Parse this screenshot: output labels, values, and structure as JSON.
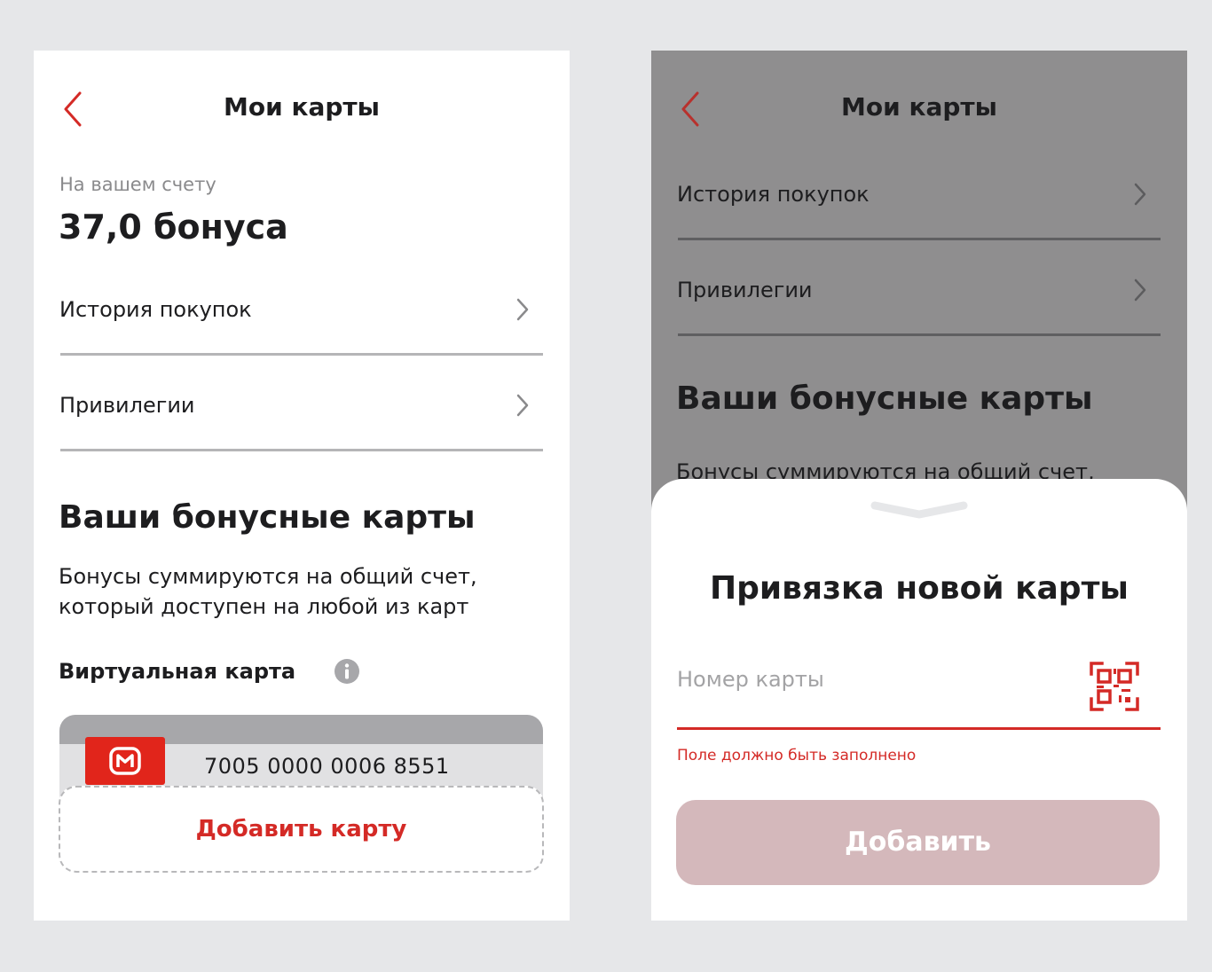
{
  "colors": {
    "accent": "#d42a26",
    "page_background": "#e6e7e9",
    "overlay": "#8f8e8f",
    "disabled_button": "#d4b8bb",
    "brand_logo": "#e1251b"
  },
  "left_screen": {
    "header": {
      "title": "Мои карты",
      "back_icon": "chevron-left-icon"
    },
    "balance": {
      "label": "На вашем счету",
      "value": "37,0 бонуса"
    },
    "menu": [
      {
        "label": "История покупок",
        "icon": "chevron-right-icon"
      },
      {
        "label": "Привилегии",
        "icon": "chevron-right-icon"
      }
    ],
    "bonus_cards": {
      "title": "Ваши бонусные карты",
      "description_line1": "Бонусы суммируются на общий счет,",
      "description_line2": "который доступен на любой из карт",
      "virtual_card_label": "Виртуальная карта",
      "info_icon": "info-icon",
      "card_number": "7005 0000 0006 8551",
      "logo_icon": "magnit-logo-icon",
      "add_card_label": "Добавить карту"
    }
  },
  "right_screen": {
    "header": {
      "title": "Мои карты",
      "back_icon": "chevron-left-icon"
    },
    "menu": [
      {
        "label": "История покупок",
        "icon": "chevron-right-icon"
      },
      {
        "label": "Привилегии",
        "icon": "chevron-right-icon"
      }
    ],
    "bonus_cards": {
      "title": "Ваши бонусные карты",
      "description_partial": "Бонусы суммируются на общий счет,"
    },
    "sheet": {
      "handle_icon": "chevron-down-handle-icon",
      "title": "Привязка новой карты",
      "card_input": {
        "placeholder": "Номер карты",
        "value": ""
      },
      "qr_icon": "qr-scan-icon",
      "error": "Поле должно быть заполнено",
      "submit_label": "Добавить"
    }
  }
}
